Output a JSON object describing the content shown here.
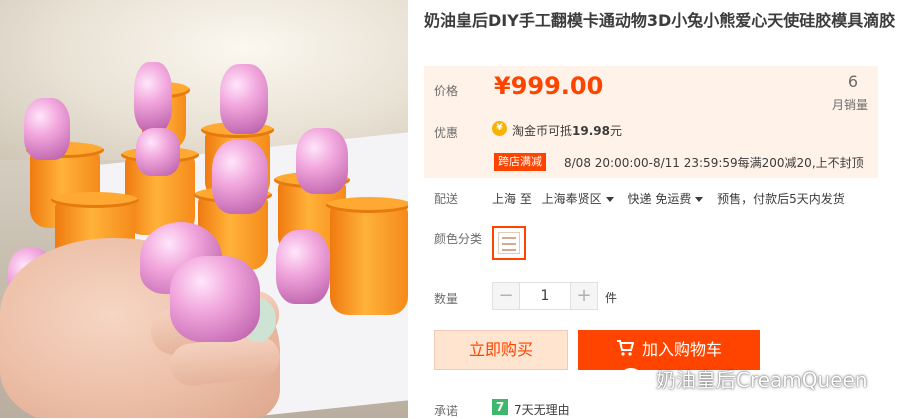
{
  "product": {
    "title": "奶油皇后DIY手工翻模卡通动物3D小兔小熊爱心天使硅胶模具滴胶"
  },
  "price": {
    "label": "价格",
    "value": "¥999.00",
    "monthly_sales": "6",
    "monthly_sales_label": "月销量"
  },
  "promo": {
    "label": "优惠",
    "coin_icon": "coin-icon",
    "coin_text_prefix": "淘金币可抵",
    "coin_amount": "19.98",
    "coin_text_suffix": "元",
    "badge": "跨店满减",
    "badge_detail": "8/08 20:00:00-8/11 23:59:59每满200减20,上不封顶"
  },
  "shipping": {
    "label": "配送",
    "from": "上海 至",
    "to": "上海奉贤区",
    "method": "快递 免运费",
    "note": "预售，付款后5天内发货"
  },
  "color": {
    "label": "颜色分类"
  },
  "quantity": {
    "label": "数量",
    "minus": "−",
    "value": "1",
    "plus": "+",
    "unit": "件"
  },
  "actions": {
    "buy_now": "立即购买",
    "add_to_cart": "加入购物车"
  },
  "promise": {
    "label": "承诺",
    "badge": "7",
    "text": "7天无理由"
  },
  "watermark": {
    "text": "奶油皇后CreamQueen",
    "icon": "wechat-icon"
  },
  "colors": {
    "accent": "#ff4400",
    "price_bg": "#fff2e8",
    "buy_now_bg": "#ffe4d0",
    "promise_green": "#3fb86d"
  }
}
